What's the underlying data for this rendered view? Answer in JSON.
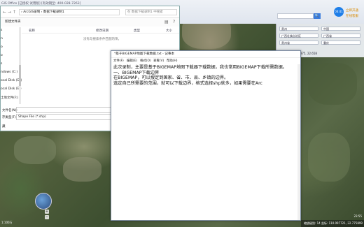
{
  "app": {
    "title": "GIS Office [已授权 试用版]  [有效期至: 400-028-7263]",
    "timer": "04:41",
    "vip_line1": "立即开通",
    "vip_line2": "在线客服",
    "search_placeholder": "",
    "search_button": "🔍"
  },
  "right_panel": {
    "row1_left": "贵州",
    "row1_right": "中国",
    "row2_left": "广西壮族自治区",
    "row2_right": "广西省",
    "row3_left": "贵州省",
    "row3_right": "重庆",
    "coord_readout": "1804 +/- 106.875, 22.658"
  },
  "explorer": {
    "nav_back": "←",
    "nav_forward": "→",
    "nav_up": "↑",
    "path": "› ArcGIS录制 › 数据下载录制1",
    "search_placeholder": "在 数据下载录制1 中搜索",
    "cmd_new_folder": "新建文件夹",
    "sidebar": [
      "s",
      "n",
      "o",
      "o",
      "s",
      "ndows (C:)",
      "ocal Disk (D:)",
      "ocal Disk (E:)",
      "土地文件(F:)",
      "土地文件(F:)"
    ],
    "columns": {
      "name": "名称",
      "modified": "修改日期",
      "type": "类型",
      "size": "大小"
    },
    "empty_msg": "没有与搜索条件匹配的项。",
    "filename_label": "文件名(N):",
    "filetype_label": "存类型(T):",
    "filetype_value": "Shape File (*.shp)",
    "hide_folders": "藏"
  },
  "notepad": {
    "title": "*基于BIGEMAP地图下载数据.txt - 记事本",
    "menu": [
      "文件(F)",
      "编辑(E)",
      "格式(O)",
      "查看(V)",
      "帮助(H)"
    ],
    "lines": [
      "此次录制，主要是基于BIGEMAP地图下载器下载数据，我也常用BIGEMAP下载所需数据。",
      "一、BIGEMAP下载边界",
      "在BIGEMAP，可以搜定到国家、省、市、县、乡镇的边界。",
      "选定自己所需要的范围，就可以下载边界，格式选择shp就多，如果需要在Arc"
    ]
  },
  "status": {
    "bar": "缩放级别: 14  坐标: 110.097721, 22.775899",
    "clock": "23:55"
  },
  "map": {
    "scale": "1:100万",
    "zoom_in": "+",
    "zoom_out": "−"
  }
}
